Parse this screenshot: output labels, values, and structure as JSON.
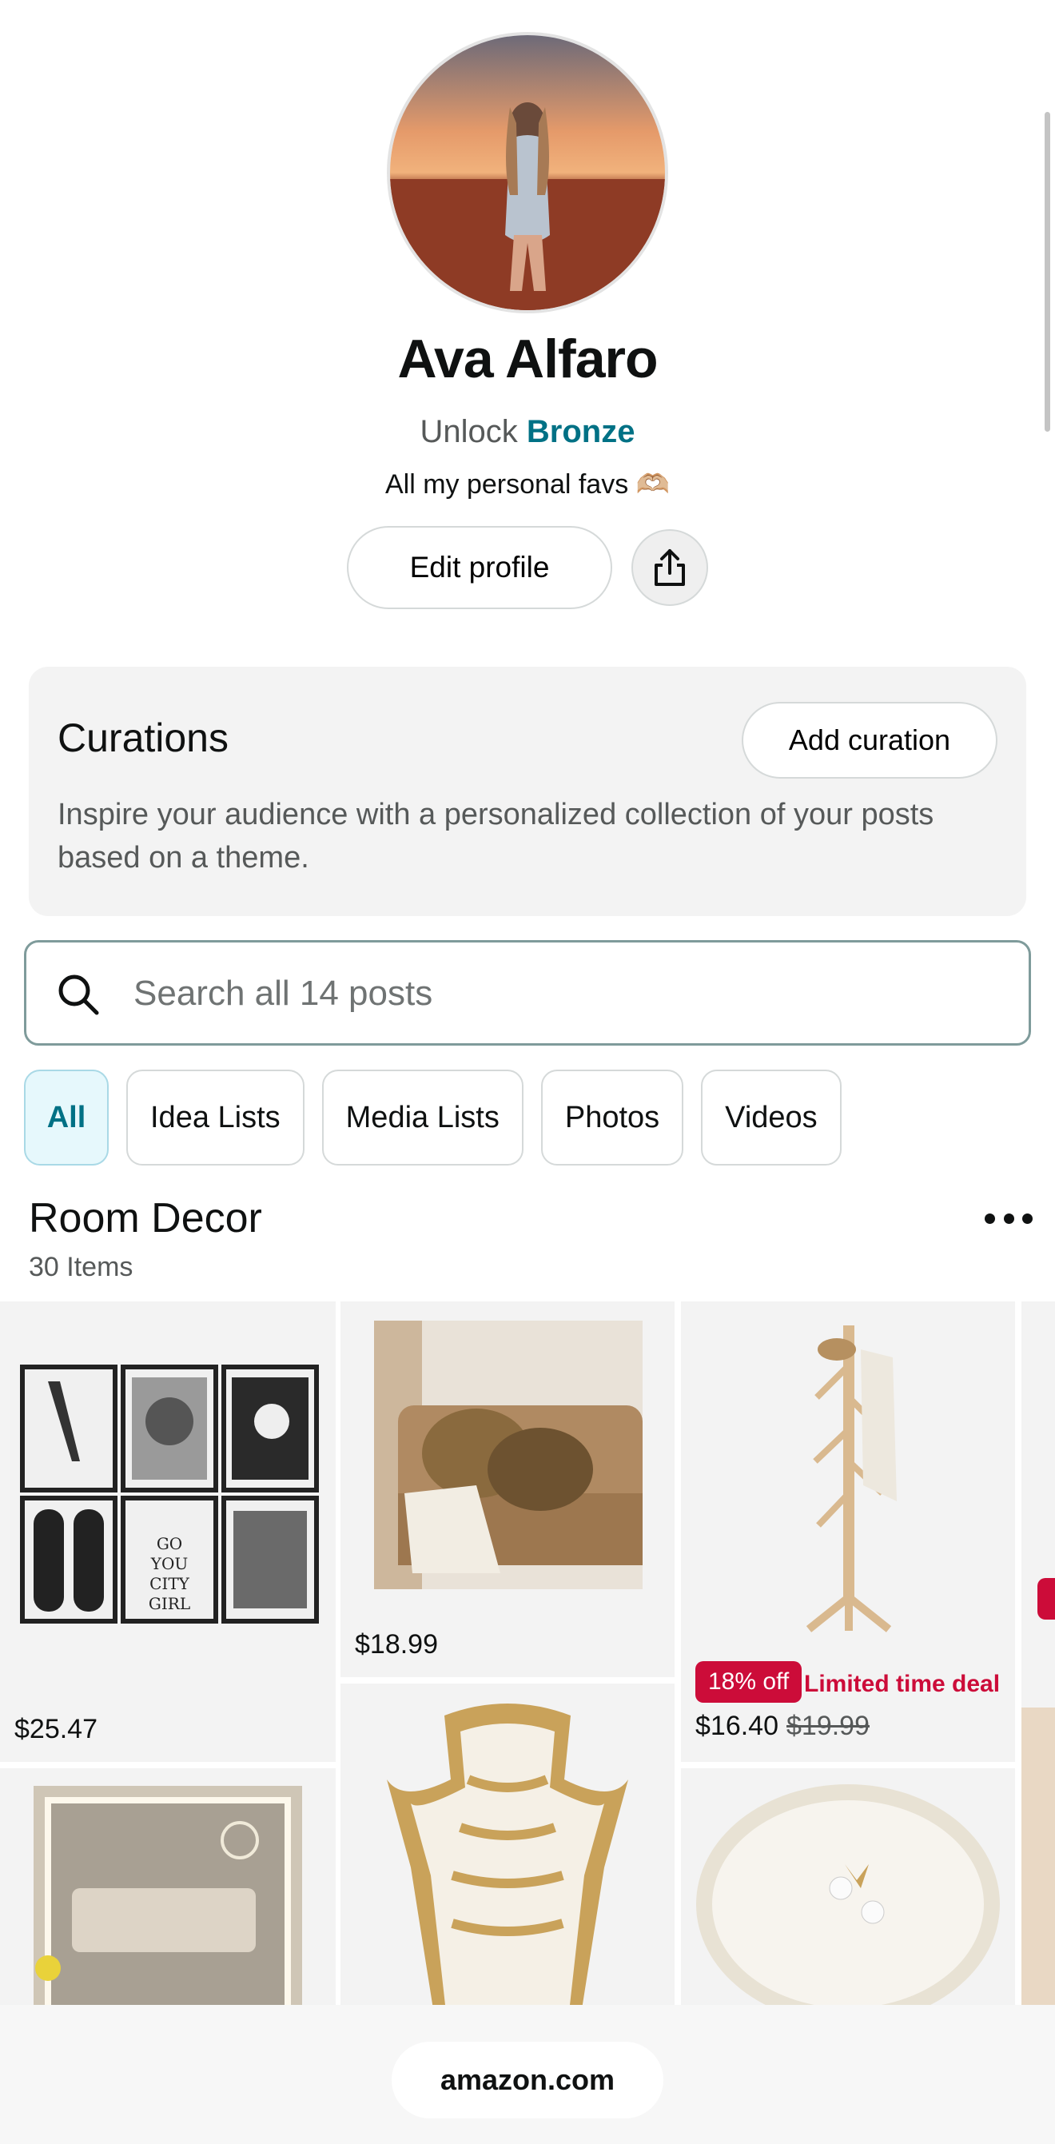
{
  "profile": {
    "name": "Ava Alfaro",
    "unlock_prefix": "Unlock",
    "unlock_tier": "Bronze",
    "bio": "All my personal favs 🫶🏼",
    "edit_label": "Edit profile",
    "share_icon": "share-icon"
  },
  "curations": {
    "title": "Curations",
    "add_label": "Add curation",
    "description": "Inspire your audience with a personalized collection of your posts based on a theme."
  },
  "search": {
    "placeholder": "Search all 14 posts",
    "icon": "search-icon"
  },
  "filters": [
    "All",
    "Idea Lists",
    "Media Lists",
    "Photos",
    "Videos"
  ],
  "active_filter": "All",
  "section": {
    "title": "Room Decor",
    "count": "30 Items",
    "more_icon": "more-dots-icon"
  },
  "products": [
    {
      "name": "wall-art-set",
      "price": "$25.47"
    },
    {
      "name": "leopard-pillows",
      "price": "$18.99"
    },
    {
      "name": "coat-rack",
      "price": "$16.40",
      "list_price": "$19.99",
      "badge": "18% off",
      "deal": "Limited time deal"
    },
    {
      "name": "vanity-mirror"
    },
    {
      "name": "zebra-tray"
    },
    {
      "name": "shell-dish"
    }
  ],
  "browser": {
    "url": "amazon.com"
  },
  "colors": {
    "accent": "#007185",
    "deal": "#cc0c39",
    "card_bg": "#f3f3f3"
  }
}
